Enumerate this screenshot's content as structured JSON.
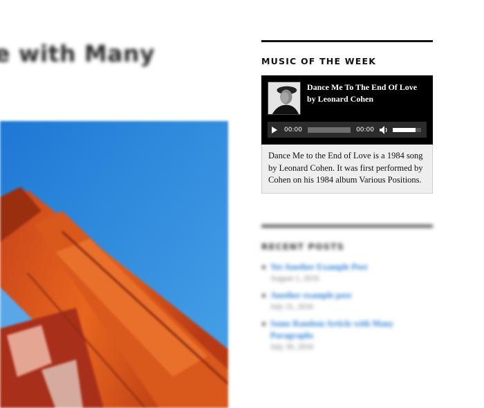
{
  "post": {
    "title": "e with Many"
  },
  "sidebar": {
    "music_widget": {
      "title": "MUSIC OF THE WEEK",
      "track_title": "Dance Me To The End Of Love",
      "track_artist": "by Leonard Cohen",
      "current_time": "00:00",
      "duration": "00:00",
      "volume_level": 0.8,
      "progress": 0,
      "description": "Dance Me to the End of Love is a 1984 song by Leonard Cohen. It was first performed by Cohen on his 1984 album Various Positions."
    },
    "recent_posts": {
      "title": "RECENT POSTS",
      "items": [
        {
          "title": "Yet Another Example Post",
          "date": "August 1, 2016"
        },
        {
          "title": "Another example post",
          "date": "July 31, 2016"
        },
        {
          "title": "Some Random Article with Many Paragraphs",
          "date": "July 30, 2016"
        }
      ]
    }
  },
  "colors": {
    "link": "#2a7fd4",
    "player_bg": "#000000",
    "description_bg": "#eeeeee"
  },
  "icons": [
    "play-icon",
    "volume-icon",
    "album-art-image"
  ]
}
